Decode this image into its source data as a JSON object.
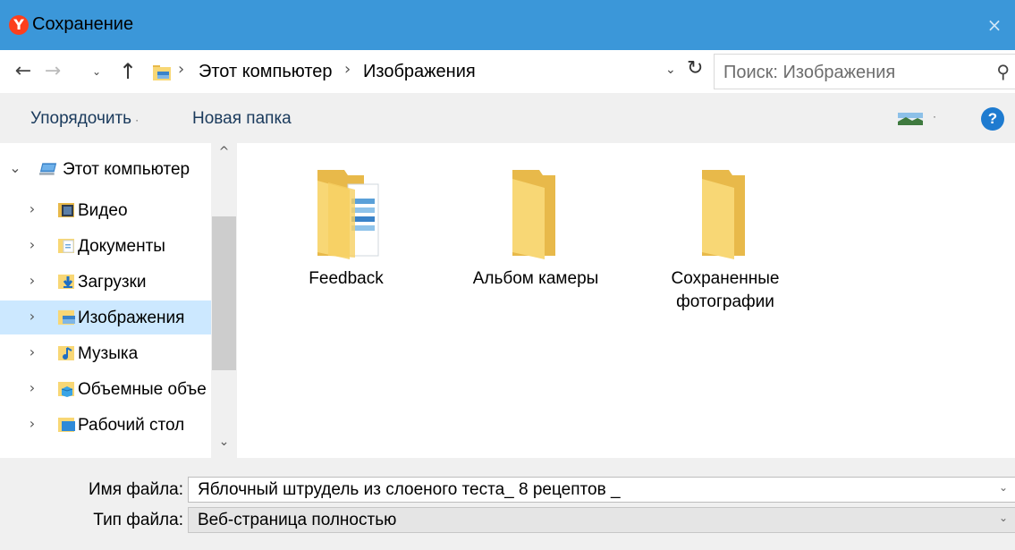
{
  "window": {
    "title": "Сохранение",
    "close_glyph": "×",
    "app_logo_letter": "Y"
  },
  "address": {
    "back_glyph": "←",
    "forward_glyph": "→",
    "recent_glyph": "⌄",
    "up_glyph": "↑",
    "separator_glyph": "›",
    "breadcrumbs": [
      "Этот компьютер",
      "Изображения"
    ],
    "dropdown_glyph": "⌄",
    "refresh_glyph": "↻",
    "search_placeholder": "Поиск: Изображения",
    "search_glyph": "⚲"
  },
  "toolbar": {
    "organize_label": "Упорядочить",
    "organize_arrow": "·",
    "new_folder_label": "Новая папка",
    "view_arrow": "·",
    "help_glyph": "?"
  },
  "nav_pane": {
    "scroll_up_glyph": "^",
    "scroll_down_glyph": "⌄",
    "items": [
      {
        "label": "Этот компьютер",
        "chevron": "⌄",
        "icon": "computer-icon",
        "selected": false
      },
      {
        "label": "Видео",
        "chevron": "›",
        "icon": "video-folder-icon",
        "selected": false
      },
      {
        "label": "Документы",
        "chevron": "›",
        "icon": "documents-folder-icon",
        "selected": false
      },
      {
        "label": "Загрузки",
        "chevron": "›",
        "icon": "downloads-folder-icon",
        "selected": false
      },
      {
        "label": "Изображения",
        "chevron": "›",
        "icon": "pictures-folder-icon",
        "selected": true
      },
      {
        "label": "Музыка",
        "chevron": "›",
        "icon": "music-folder-icon",
        "selected": false
      },
      {
        "label": "Объемные объе",
        "chevron": "›",
        "icon": "3d-objects-folder-icon",
        "selected": false
      },
      {
        "label": "Рабочий стол",
        "chevron": "›",
        "icon": "desktop-folder-icon",
        "selected": false
      }
    ]
  },
  "folders": [
    {
      "name": "Feedback",
      "icon": "feedback-folder-icon"
    },
    {
      "name": "Альбом камеры",
      "icon": "folder-icon"
    },
    {
      "name": "Сохраненные фотографии",
      "icon": "folder-icon"
    }
  ],
  "fields": {
    "filename_label": "Имя файла:",
    "filename_value": "Яблочный штрудель из слоеного теста_ 8 рецептов _",
    "filetype_label": "Тип файла:",
    "filetype_value": "Веб-страница полностью",
    "dropdown_glyph": "⌄"
  },
  "colors": {
    "titlebar": "#3b97d9",
    "toolbar": "#f0f0f0",
    "selection": "#cce8ff",
    "folder_yellow": "#f8d775",
    "folder_dark": "#e8b94a",
    "help_blue": "#1e7bd0"
  }
}
